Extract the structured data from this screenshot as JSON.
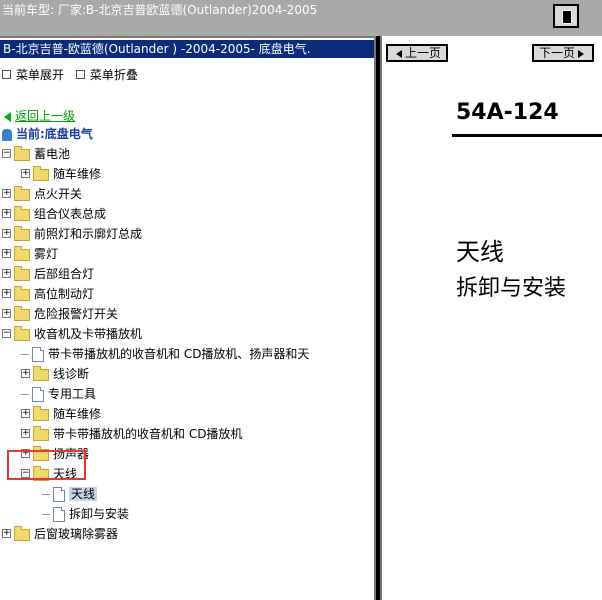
{
  "window": {
    "title": "当前车型:  厂家:B-北京吉普欧蓝德(Outlander)2004-2005"
  },
  "left_panel": {
    "title": "B-北京吉普-欧蓝德(Outlander ) -2004-2005- 底盘电气.",
    "menu_ops": {
      "expand_label": "菜单展开",
      "collapse_label": "菜单折叠"
    },
    "back_label": "返回上一级",
    "current_label": "当前:底盘电气",
    "tree": [
      {
        "label": "蓄电池",
        "level": 0,
        "expanded": true
      },
      {
        "label": "随车维修",
        "level": 1,
        "expanded": false
      },
      {
        "label": "点火开关",
        "level": 0,
        "expanded": false
      },
      {
        "label": "组合仪表总成",
        "level": 0,
        "expanded": false
      },
      {
        "label": "前照灯和示廓灯总成",
        "level": 0,
        "expanded": false
      },
      {
        "label": "雾灯",
        "level": 0,
        "expanded": false
      },
      {
        "label": "后部组合灯",
        "level": 0,
        "expanded": false
      },
      {
        "label": "高位制动灯",
        "level": 0,
        "expanded": false
      },
      {
        "label": "危险报警灯开关",
        "level": 0,
        "expanded": false
      },
      {
        "label": "收音机及卡带播放机",
        "level": 0,
        "expanded": true
      },
      {
        "label": "带卡带播放机的收音机和 CD播放机、扬声器和天",
        "level": 1,
        "type": "doc"
      },
      {
        "label": "线诊断",
        "level": 1,
        "expanded": false
      },
      {
        "label": "专用工具",
        "level": 1,
        "type": "doc"
      },
      {
        "label": "随车维修",
        "level": 1,
        "expanded": false
      },
      {
        "label": "带卡带播放机的收音机和 CD播放机",
        "level": 1,
        "expanded": false
      },
      {
        "label": "扬声器",
        "level": 1,
        "expanded": false
      },
      {
        "label": "天线",
        "level": 1,
        "expanded": true
      },
      {
        "label": "天线",
        "level": 2,
        "type": "doc",
        "selected": true
      },
      {
        "label": "拆卸与安装",
        "level": 2,
        "type": "doc"
      },
      {
        "label": "后窗玻璃除雾器",
        "level": 0,
        "expanded": false
      }
    ]
  },
  "right_panel": {
    "prev_label": "上一页",
    "next_label": "下一页",
    "doc_number": "54A-124",
    "doc_title": "天线",
    "doc_subtitle": "拆卸与安装"
  }
}
